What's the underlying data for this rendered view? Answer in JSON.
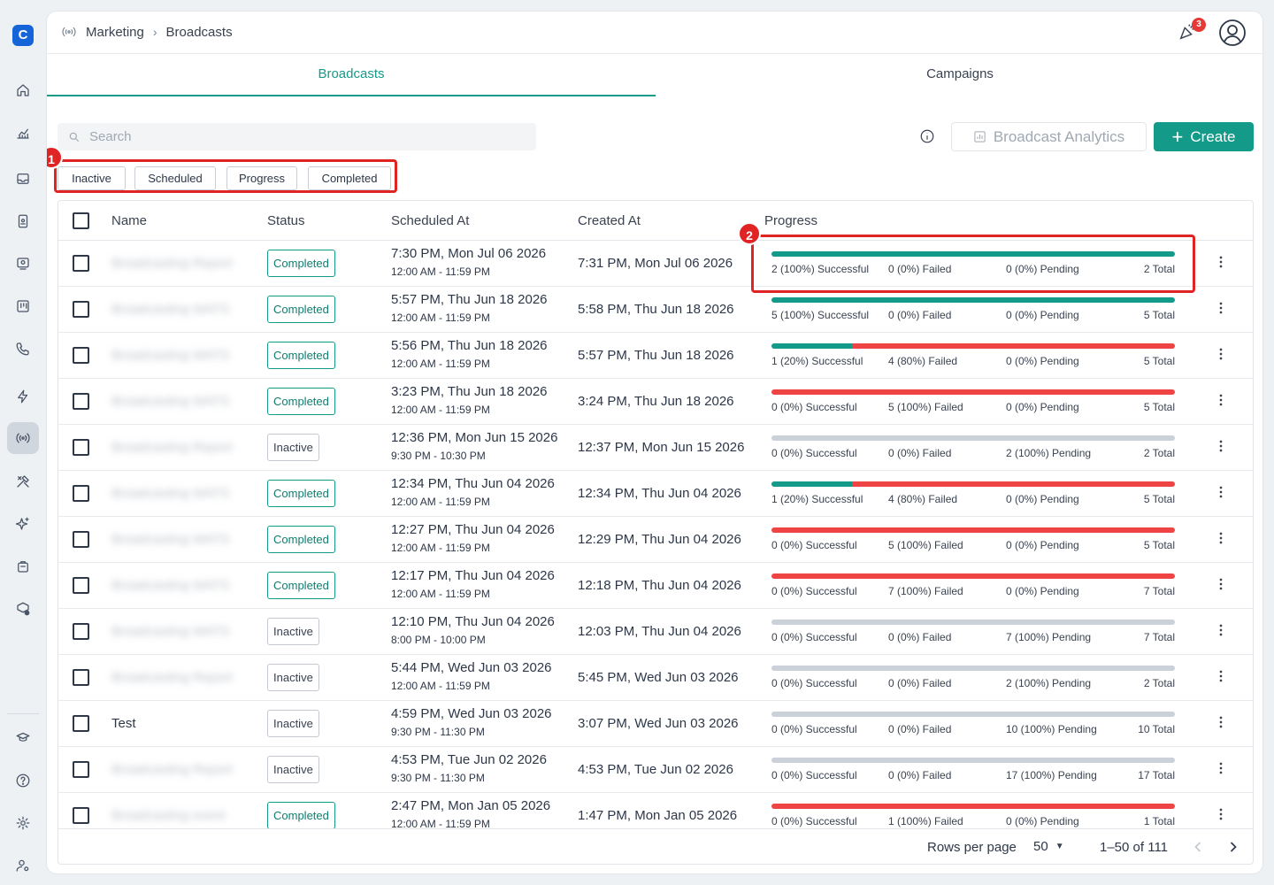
{
  "breadcrumb": {
    "section": "Marketing",
    "page": "Broadcasts"
  },
  "header": {
    "notification_count": "3"
  },
  "tabs": [
    {
      "label": "Broadcasts",
      "active": true
    },
    {
      "label": "Campaigns",
      "active": false
    }
  ],
  "search": {
    "placeholder": "Search",
    "value": ""
  },
  "toolbar": {
    "analytics_label": "Broadcast Analytics",
    "create_label": "Create"
  },
  "filters": [
    "Inactive",
    "Scheduled",
    "Progress",
    "Completed"
  ],
  "markers": {
    "filters": "1",
    "progress": "2"
  },
  "table": {
    "columns": {
      "name": "Name",
      "status": "Status",
      "scheduled": "Scheduled At",
      "created": "Created At",
      "progress": "Progress"
    },
    "rows": [
      {
        "name": "Broadcasting Report",
        "blurred": true,
        "status": "Completed",
        "scheduled": "7:30 PM, Mon Jul 06 2026",
        "window": "12:00 AM - 11:59 PM",
        "created": "7:31 PM, Mon Jul 06 2026",
        "success": 2,
        "failed": 0,
        "pending": 0,
        "total": 2,
        "success_text": "2 (100%) Successful",
        "failed_text": "0 (0%) Failed",
        "pending_text": "0 (0%) Pending",
        "total_text": "2 Total"
      },
      {
        "name": "Broadcasting WATS",
        "blurred": true,
        "status": "Completed",
        "scheduled": "5:57 PM, Thu Jun 18 2026",
        "window": "12:00 AM - 11:59 PM",
        "created": "5:58 PM, Thu Jun 18 2026",
        "success": 5,
        "failed": 0,
        "pending": 0,
        "total": 5,
        "success_text": "5 (100%) Successful",
        "failed_text": "0 (0%) Failed",
        "pending_text": "0 (0%) Pending",
        "total_text": "5 Total"
      },
      {
        "name": "Broadcasting WATS",
        "blurred": true,
        "status": "Completed",
        "scheduled": "5:56 PM, Thu Jun 18 2026",
        "window": "12:00 AM - 11:59 PM",
        "created": "5:57 PM, Thu Jun 18 2026",
        "success": 1,
        "failed": 4,
        "pending": 0,
        "total": 5,
        "success_text": "1 (20%) Successful",
        "failed_text": "4 (80%) Failed",
        "pending_text": "0 (0%) Pending",
        "total_text": "5 Total"
      },
      {
        "name": "Broadcasting WATS",
        "blurred": true,
        "status": "Completed",
        "scheduled": "3:23 PM, Thu Jun 18 2026",
        "window": "12:00 AM - 11:59 PM",
        "created": "3:24 PM, Thu Jun 18 2026",
        "success": 0,
        "failed": 5,
        "pending": 0,
        "total": 5,
        "success_text": "0 (0%) Successful",
        "failed_text": "5 (100%) Failed",
        "pending_text": "0 (0%) Pending",
        "total_text": "5 Total"
      },
      {
        "name": "Broadcasting Report",
        "blurred": true,
        "status": "Inactive",
        "scheduled": "12:36 PM, Mon Jun 15 2026",
        "window": "9:30 PM - 10:30 PM",
        "created": "12:37 PM, Mon Jun 15 2026",
        "success": 0,
        "failed": 0,
        "pending": 2,
        "total": 2,
        "success_text": "0 (0%) Successful",
        "failed_text": "0 (0%) Failed",
        "pending_text": "2 (100%) Pending",
        "total_text": "2 Total"
      },
      {
        "name": "Broadcasting WATS",
        "blurred": true,
        "status": "Completed",
        "scheduled": "12:34 PM, Thu Jun 04 2026",
        "window": "12:00 AM - 11:59 PM",
        "created": "12:34 PM, Thu Jun 04 2026",
        "success": 1,
        "failed": 4,
        "pending": 0,
        "total": 5,
        "success_text": "1 (20%) Successful",
        "failed_text": "4 (80%) Failed",
        "pending_text": "0 (0%) Pending",
        "total_text": "5 Total"
      },
      {
        "name": "Broadcasting WATS",
        "blurred": true,
        "status": "Completed",
        "scheduled": "12:27 PM, Thu Jun 04 2026",
        "window": "12:00 AM - 11:59 PM",
        "created": "12:29 PM, Thu Jun 04 2026",
        "success": 0,
        "failed": 5,
        "pending": 0,
        "total": 5,
        "success_text": "0 (0%) Successful",
        "failed_text": "5 (100%) Failed",
        "pending_text": "0 (0%) Pending",
        "total_text": "5 Total"
      },
      {
        "name": "Broadcasting WATS",
        "blurred": true,
        "status": "Completed",
        "scheduled": "12:17 PM, Thu Jun 04 2026",
        "window": "12:00 AM - 11:59 PM",
        "created": "12:18 PM, Thu Jun 04 2026",
        "success": 0,
        "failed": 7,
        "pending": 0,
        "total": 7,
        "success_text": "0 (0%) Successful",
        "failed_text": "7 (100%) Failed",
        "pending_text": "0 (0%) Pending",
        "total_text": "7 Total"
      },
      {
        "name": "Broadcasting WATS",
        "blurred": true,
        "status": "Inactive",
        "scheduled": "12:10 PM, Thu Jun 04 2026",
        "window": "8:00 PM - 10:00 PM",
        "created": "12:03 PM, Thu Jun 04 2026",
        "success": 0,
        "failed": 0,
        "pending": 7,
        "total": 7,
        "success_text": "0 (0%) Successful",
        "failed_text": "0 (0%) Failed",
        "pending_text": "7 (100%) Pending",
        "total_text": "7 Total"
      },
      {
        "name": "Broadcasting Report",
        "blurred": true,
        "status": "Inactive",
        "scheduled": "5:44 PM, Wed Jun 03 2026",
        "window": "12:00 AM - 11:59 PM",
        "created": "5:45 PM, Wed Jun 03 2026",
        "success": 0,
        "failed": 0,
        "pending": 2,
        "total": 2,
        "success_text": "0 (0%) Successful",
        "failed_text": "0 (0%) Failed",
        "pending_text": "2 (100%) Pending",
        "total_text": "2 Total"
      },
      {
        "name": "Test",
        "blurred": false,
        "status": "Inactive",
        "scheduled": "4:59 PM, Wed Jun 03 2026",
        "window": "9:30 PM - 11:30 PM",
        "created": "3:07 PM, Wed Jun 03 2026",
        "success": 0,
        "failed": 0,
        "pending": 10,
        "total": 10,
        "success_text": "0 (0%) Successful",
        "failed_text": "0 (0%) Failed",
        "pending_text": "10 (100%) Pending",
        "total_text": "10 Total"
      },
      {
        "name": "Broadcasting Report",
        "blurred": true,
        "status": "Inactive",
        "scheduled": "4:53 PM, Tue Jun 02 2026",
        "window": "9:30 PM - 11:30 PM",
        "created": "4:53 PM, Tue Jun 02 2026",
        "success": 0,
        "failed": 0,
        "pending": 17,
        "total": 17,
        "success_text": "0 (0%) Successful",
        "failed_text": "0 (0%) Failed",
        "pending_text": "17 (100%) Pending",
        "total_text": "17 Total"
      },
      {
        "name": "Broadcasting event",
        "blurred": true,
        "status": "Completed",
        "scheduled": "2:47 PM, Mon Jan 05 2026",
        "window": "12:00 AM - 11:59 PM",
        "created": "1:47 PM, Mon Jan 05 2026",
        "success": 0,
        "failed": 1,
        "pending": 0,
        "total": 1,
        "success_text": "0 (0%) Successful",
        "failed_text": "1 (100%) Failed",
        "pending_text": "0 (0%) Pending",
        "total_text": "1 Total"
      }
    ]
  },
  "pagination": {
    "rows_per_page_label": "Rows per page",
    "rows_per_page": "50",
    "range": "1–50 of 111"
  },
  "colors": {
    "accent": "#149a88",
    "success": "#149a88",
    "failed": "#ef4444",
    "pending": "#cbd1d8",
    "highlight": "#e02424"
  },
  "sidebar_icons": [
    "home-icon",
    "analytics-icon",
    "inbox-icon",
    "contacts-icon",
    "team-icon",
    "board-icon",
    "phone-icon",
    "automation-icon",
    "broadcast-icon",
    "tools-icon",
    "ai-sparkle-icon",
    "orders-icon",
    "integrations-icon",
    "learn-icon",
    "help-icon",
    "settings-icon",
    "account-icon"
  ]
}
